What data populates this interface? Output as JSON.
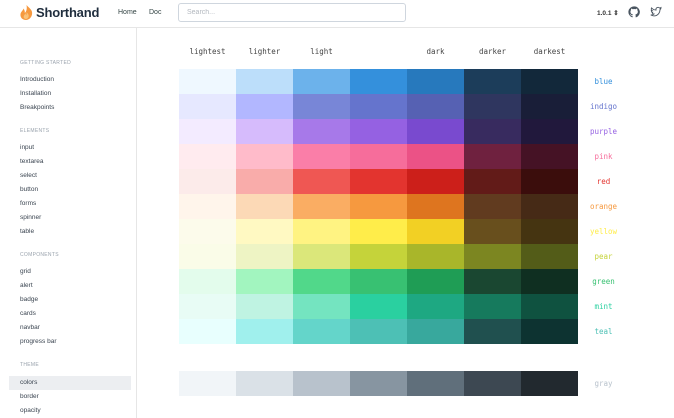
{
  "header": {
    "brand": "Shorthand",
    "nav": [
      "Home",
      "Doc"
    ],
    "search_placeholder": "Search...",
    "version": "1.0.1 ⇕",
    "icons": [
      "github-icon",
      "twitter-icon"
    ]
  },
  "sidebar": {
    "sections": [
      {
        "title": "GETTING STARTED",
        "items": [
          "Introduction",
          "Installation",
          "Breakpoints"
        ]
      },
      {
        "title": "ELEMENTS",
        "items": [
          "input",
          "textarea",
          "select",
          "button",
          "forms",
          "spinner",
          "table"
        ]
      },
      {
        "title": "COMPONENTS",
        "items": [
          "grid",
          "alert",
          "badge",
          "cards",
          "navbar",
          "progress bar"
        ]
      },
      {
        "title": "THEME",
        "items": [
          "colors",
          "border",
          "opacity"
        ]
      }
    ],
    "active": "colors"
  },
  "palette": {
    "columns": [
      "lightest",
      "lighter",
      "light",
      "",
      "dark",
      "darker",
      "darkest"
    ],
    "rows": [
      {
        "name": "blue",
        "label_color": "#3490dc",
        "shades": [
          "#eff8ff",
          "#bcdefa",
          "#6cb2eb",
          "#3490dc",
          "#2779bd",
          "#1c3d5a",
          "#12283a"
        ]
      },
      {
        "name": "indigo",
        "label_color": "#6574cd",
        "shades": [
          "#e6e8ff",
          "#b2b7ff",
          "#7886d7",
          "#6574cd",
          "#5661b3",
          "#2f365f",
          "#191e38"
        ]
      },
      {
        "name": "purple",
        "label_color": "#9561e2",
        "shades": [
          "#f3ebff",
          "#d6bbfc",
          "#a779e9",
          "#9561e2",
          "#794acf",
          "#382b5f",
          "#21183c"
        ]
      },
      {
        "name": "pink",
        "label_color": "#f66d9b",
        "shades": [
          "#ffebef",
          "#ffbbca",
          "#fa7ea8",
          "#f66d9b",
          "#eb5286",
          "#6f213f",
          "#451225"
        ]
      },
      {
        "name": "red",
        "label_color": "#e3342f",
        "shades": [
          "#fcebea",
          "#f9acaa",
          "#ef5753",
          "#e3342f",
          "#cc1f1a",
          "#621b18",
          "#3b0d0c"
        ]
      },
      {
        "name": "orange",
        "label_color": "#f6993f",
        "shades": [
          "#fff5eb",
          "#fcd9b6",
          "#faad63",
          "#f6993f",
          "#de751f",
          "#613b1f",
          "#462a16"
        ]
      },
      {
        "name": "yellow",
        "label_color": "#ffed4a",
        "shades": [
          "#fcfbeb",
          "#fff9c2",
          "#fff382",
          "#ffed4a",
          "#f2d024",
          "#684f1d",
          "#453411"
        ]
      },
      {
        "name": "pear",
        "label_color": "#c5d33a",
        "shades": [
          "#fafce8",
          "#eef4c4",
          "#dbe77a",
          "#c5d33a",
          "#a9b62a",
          "#7c8621",
          "#535c18"
        ]
      },
      {
        "name": "green",
        "label_color": "#38c172",
        "shades": [
          "#e3fcec",
          "#a2f5bf",
          "#51d88a",
          "#38c172",
          "#1f9d55",
          "#1a4731",
          "#0f2f21"
        ]
      },
      {
        "name": "mint",
        "label_color": "#2ad0a0",
        "shades": [
          "#e8fcf5",
          "#bff3e2",
          "#74e4c0",
          "#2ad0a0",
          "#1ea882",
          "#167a5d",
          "#0f5240"
        ]
      },
      {
        "name": "teal",
        "label_color": "#4dc0b5",
        "shades": [
          "#e8fffe",
          "#a0f0ed",
          "#64d5ca",
          "#4dc0b5",
          "#38a89d",
          "#20504f",
          "#0d3331"
        ]
      }
    ],
    "gray": {
      "name": "gray",
      "label_color": "#b8c2cc",
      "shades": [
        "#f1f5f8",
        "#dae1e7",
        "#b8c2cc",
        "#8795a1",
        "#606f7b",
        "#3d4852",
        "#22292f"
      ]
    }
  },
  "colors": {
    "accent_orange": "#f6993f",
    "text_dark": "#1f2d3d",
    "border": "#e6e6e6"
  }
}
